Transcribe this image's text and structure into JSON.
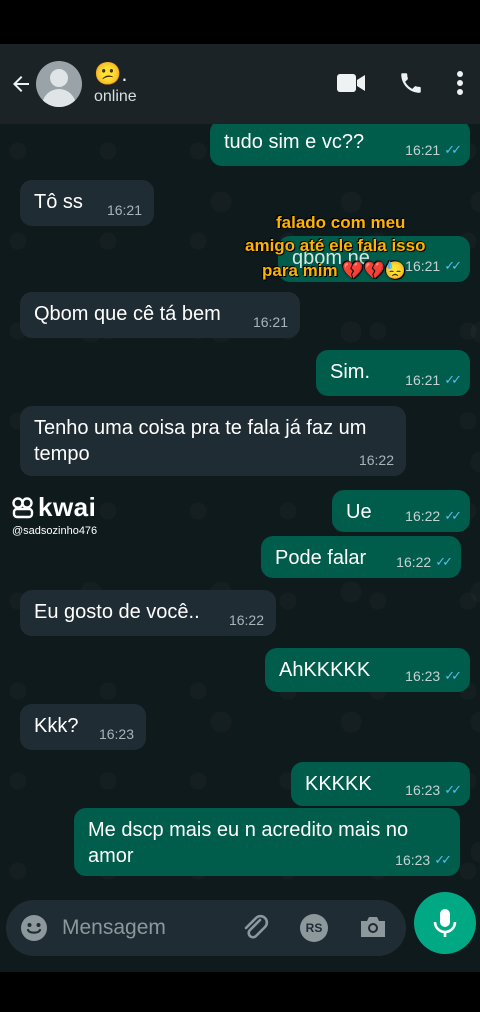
{
  "header": {
    "contact_emoji": "😕.",
    "status": "online",
    "icons": [
      "back-arrow-icon",
      "video-call-icon",
      "phone-icon",
      "more-vert-icon"
    ]
  },
  "messages": [
    {
      "dir": "out",
      "text": "tudo sim e vc??",
      "time": "16:21",
      "read": true
    },
    {
      "dir": "in",
      "text": "Tô ss",
      "time": "16:21"
    },
    {
      "dir": "out",
      "text": "qbom né",
      "time": "16:21",
      "read": true
    },
    {
      "dir": "in",
      "text": "Qbom que cê tá bem",
      "time": "16:21"
    },
    {
      "dir": "out",
      "text": "Sim.",
      "time": "16:21",
      "read": true
    },
    {
      "dir": "in",
      "text": "Tenho uma coisa pra te fala já faz um tempo",
      "time": "16:22"
    },
    {
      "dir": "out",
      "text": "Ue",
      "time": "16:22",
      "read": true
    },
    {
      "dir": "out",
      "text": "Pode falar",
      "time": "16:22",
      "read": true
    },
    {
      "dir": "in",
      "text": "Eu gosto de você..",
      "time": "16:22"
    },
    {
      "dir": "out",
      "text": "AhKKKKK",
      "time": "16:23",
      "read": true
    },
    {
      "dir": "in",
      "text": "Kkk?",
      "time": "16:23"
    },
    {
      "dir": "out",
      "text": "KKKKK",
      "time": "16:23",
      "read": true
    },
    {
      "dir": "out",
      "text": "Me dscp mais eu n acredito mais no amor",
      "time": "16:23",
      "read": true
    }
  ],
  "overlay": {
    "line1": "falado com meu",
    "line2": "amigo até ele fala isso",
    "line3": "para mim 💔💔😓"
  },
  "watermark": {
    "logo": "kwai",
    "handle": "@sadsozinho476"
  },
  "input": {
    "placeholder": "Mensagem",
    "icons": [
      "emoji-icon",
      "attach-icon",
      "rs-payment-icon",
      "camera-icon",
      "mic-icon"
    ],
    "rs_label": "RS"
  },
  "colors": {
    "header_bg": "#1b2327",
    "chat_bg": "#0f1a1d",
    "incoming_bubble": "#1f2c33",
    "outgoing_bubble": "#005c4b",
    "read_ticks": "#53bdeb",
    "mic_button": "#00a884",
    "overlay_text": "#ffb300"
  }
}
